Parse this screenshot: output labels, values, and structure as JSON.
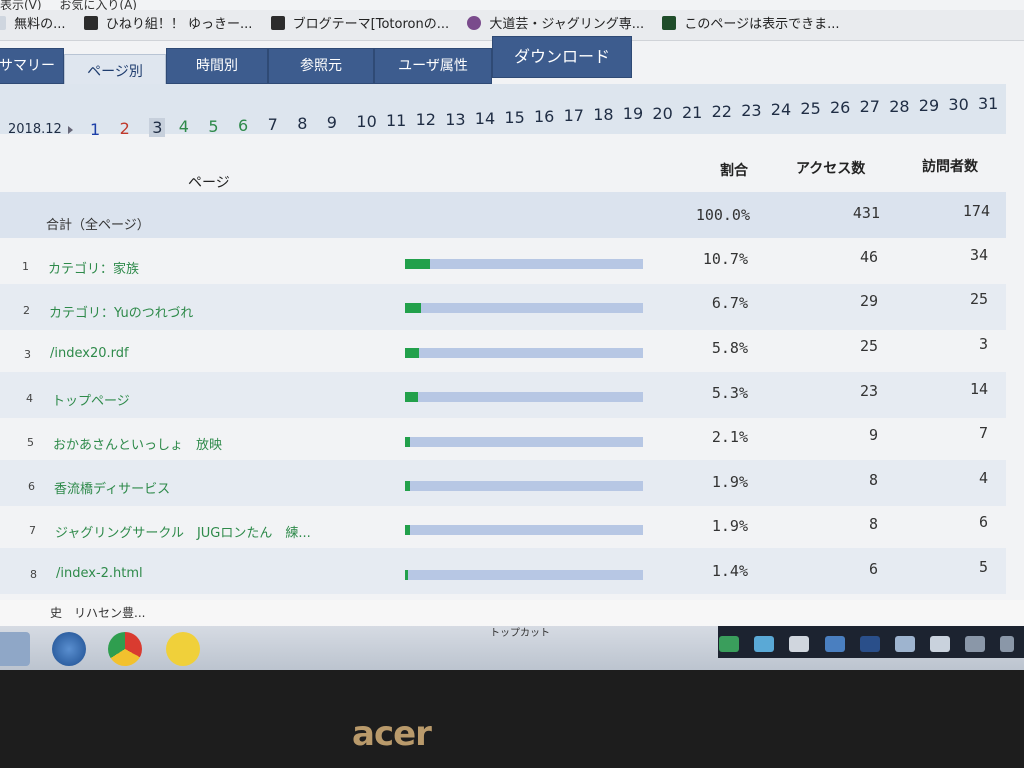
{
  "browser": {
    "menu": [
      "表示(V)",
      "お気に入り(A)"
    ],
    "bookmarks": [
      {
        "label": "無料の...",
        "icon": "page-icon"
      },
      {
        "label": "ひねり組！！ ゆっきー...",
        "icon": "favicon-icon"
      },
      {
        "label": "ブログテーマ[Totoronの...",
        "icon": "favicon-icon"
      },
      {
        "label": "大道芸・ジャグリング専...",
        "icon": "favicon-icon"
      },
      {
        "label": "このページは表示できま...",
        "icon": "favicon-icon"
      }
    ]
  },
  "tabs": [
    {
      "label": "サマリー"
    },
    {
      "label": "ページ別"
    },
    {
      "label": "時間別"
    },
    {
      "label": "参照元"
    },
    {
      "label": "ユーザ属性"
    },
    {
      "label": "ダウンロード"
    }
  ],
  "date_nav": {
    "month": "2018.12",
    "days": [
      "1",
      "2",
      "3",
      "4",
      "5",
      "6",
      "7",
      "8",
      "9",
      "10",
      "11",
      "12",
      "13",
      "14",
      "15",
      "16",
      "17",
      "18",
      "19",
      "20",
      "21",
      "22",
      "23",
      "24",
      "25",
      "26",
      "27",
      "28",
      "29",
      "30",
      "31"
    ],
    "selected_day": "3"
  },
  "table": {
    "headers": {
      "page": "ページ",
      "ratio": "割合",
      "access": "アクセス数",
      "visitors": "訪問者数"
    },
    "total": {
      "label": "合計（全ページ）",
      "ratio": "100.0%",
      "access": "431",
      "visitors": "174"
    },
    "rows": [
      {
        "rank": "1",
        "page": "カテゴリ：家族",
        "ratio": "10.7%",
        "ratio_value": 10.7,
        "access": "46",
        "visitors": "34"
      },
      {
        "rank": "2",
        "page": "カテゴリ：Yuのつれづれ",
        "ratio": "6.7%",
        "ratio_value": 6.7,
        "access": "29",
        "visitors": "25"
      },
      {
        "rank": "3",
        "page": "/index20.rdf",
        "ratio": "5.8%",
        "ratio_value": 5.8,
        "access": "25",
        "visitors": "3"
      },
      {
        "rank": "4",
        "page": "トップページ",
        "ratio": "5.3%",
        "ratio_value": 5.3,
        "access": "23",
        "visitors": "14"
      },
      {
        "rank": "5",
        "page": "おかあさんといっしょ　放映",
        "ratio": "2.1%",
        "ratio_value": 2.1,
        "access": "9",
        "visitors": "7"
      },
      {
        "rank": "6",
        "page": "香流橋ディサービス",
        "ratio": "1.9%",
        "ratio_value": 1.9,
        "access": "8",
        "visitors": "4"
      },
      {
        "rank": "7",
        "page": "ジャグリングサークル　JUGロンたん　練...",
        "ratio": "1.9%",
        "ratio_value": 1.9,
        "access": "8",
        "visitors": "6"
      },
      {
        "rank": "8",
        "page": "/index-2.html",
        "ratio": "1.4%",
        "ratio_value": 1.4,
        "access": "6",
        "visitors": "5"
      }
    ]
  },
  "status_bar": {
    "text": "史　リハセン豊..."
  },
  "taskbar": {
    "center_label": "トップカット"
  },
  "colors": {
    "tab_bg": "#3d5c8e",
    "bar_fill": "#22a04b",
    "bar_bg": "#b7c7e4",
    "page_link": "#2e8a4a"
  },
  "device": {
    "brand": "acer"
  }
}
